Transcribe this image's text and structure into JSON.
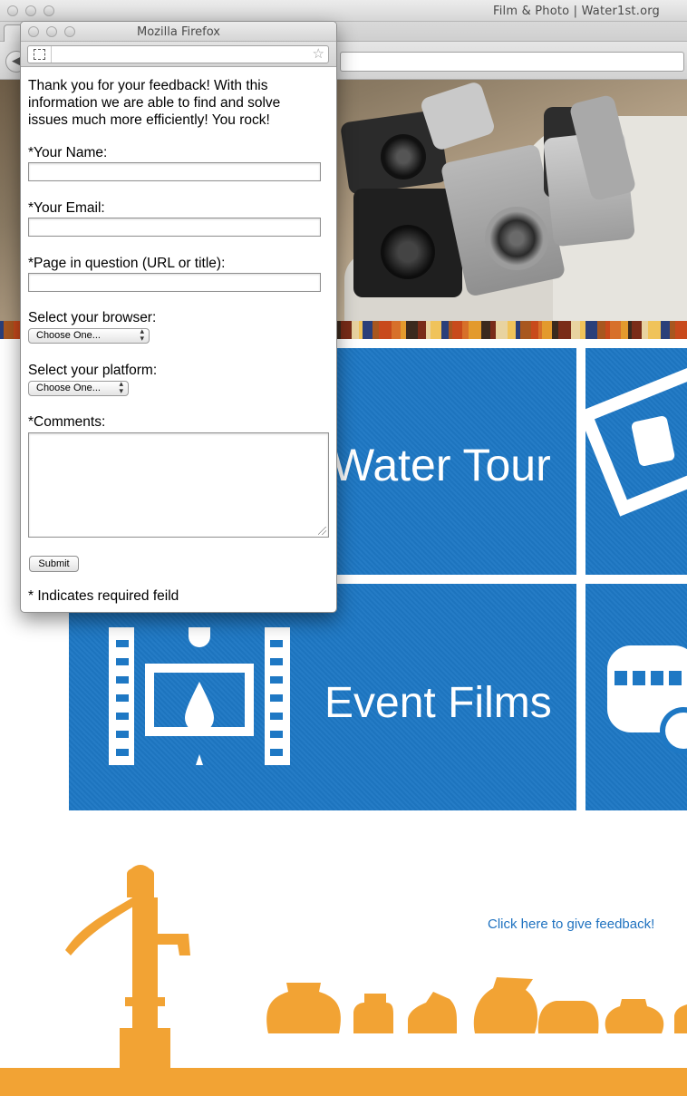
{
  "main_window": {
    "title": "Film & Photo | Water1st.org"
  },
  "tiles": {
    "water_tour_label": "Water Tour",
    "event_films_label": "Event Films",
    "color": "#1e78c4"
  },
  "footer": {
    "feedback_link": "Click here to give feedback!",
    "link_color": "#1f72c0",
    "silhouette_color": "#f2a334"
  },
  "popup": {
    "window_title": "Mozilla Firefox",
    "intro_text": "Thank you for your feedback! With this information we are able to find and solve issues much more efficiently! You rock!",
    "fields": {
      "name_label": "*Your Name:",
      "name_value": "",
      "email_label": "*Your Email:",
      "email_value": "",
      "page_label": "*Page in question (URL or title):",
      "page_value": "",
      "browser_label": "Select your browser:",
      "browser_selected": "Choose One...",
      "platform_label": "Select your platform:",
      "platform_selected": "Choose One...",
      "comments_label": "*Comments:",
      "comments_value": ""
    },
    "submit_label": "Submit",
    "required_note": "* Indicates required feild"
  }
}
